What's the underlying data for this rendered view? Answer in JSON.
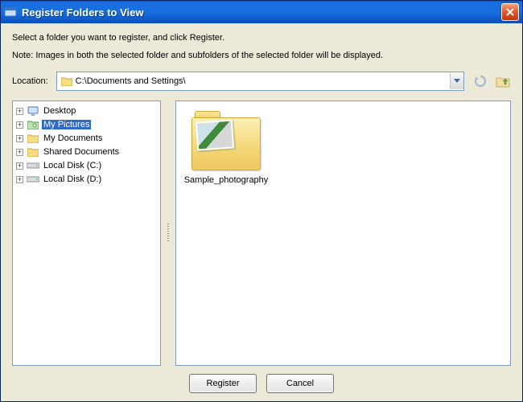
{
  "title": "Register Folders to View",
  "instruction": "Select a folder you want to register, and click Register.",
  "note": "Note: Images in both the selected folder and subfolders of the selected folder will be displayed.",
  "location": {
    "label": "Location:",
    "value": "C:\\Documents and Settings\\"
  },
  "tree": [
    {
      "label": "Desktop",
      "icon": "monitor",
      "selected": false
    },
    {
      "label": "My Pictures",
      "icon": "pictures",
      "selected": true
    },
    {
      "label": "My Documents",
      "icon": "folder",
      "selected": false
    },
    {
      "label": "Shared Documents",
      "icon": "folder",
      "selected": false
    },
    {
      "label": "Local Disk (C:)",
      "icon": "drive",
      "selected": false
    },
    {
      "label": "Local Disk (D:)",
      "icon": "drive",
      "selected": false
    }
  ],
  "content": {
    "items": [
      {
        "label": "Sample_photography"
      }
    ]
  },
  "buttons": {
    "register": "Register",
    "cancel": "Cancel"
  }
}
